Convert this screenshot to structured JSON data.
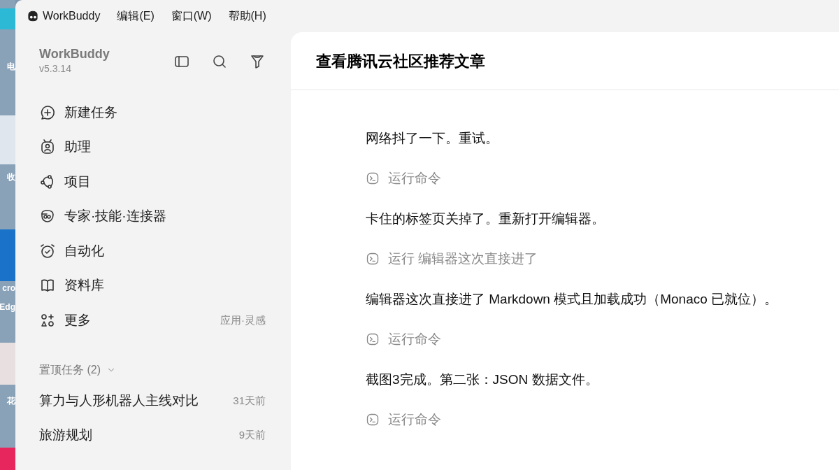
{
  "desktop_icons": [
    {
      "label": "电"
    },
    {
      "label": "收"
    },
    {
      "label": "cro"
    },
    {
      "label": "Edg"
    },
    {
      "label": "花"
    }
  ],
  "menu_bar": {
    "app_name": "WorkBuddy",
    "items": [
      "编辑(E)",
      "窗口(W)",
      "帮助(H)"
    ]
  },
  "sidebar": {
    "app_name": "WorkBuddy",
    "version": "v5.3.14",
    "nav_items": [
      {
        "kind": "new-task",
        "label": "新建任务"
      },
      {
        "kind": "assistant",
        "label": "助理"
      },
      {
        "kind": "project",
        "label": "项目"
      },
      {
        "kind": "experts",
        "label": "专家·技能·连接器"
      },
      {
        "kind": "automation",
        "label": "自动化"
      },
      {
        "kind": "library",
        "label": "资料库"
      },
      {
        "kind": "more",
        "label": "更多",
        "hint": "应用·灵感"
      }
    ],
    "pinned": {
      "title": "置顶任务 (2)",
      "expanded": true,
      "tasks": [
        {
          "title": "算力与人形机器人主线对比",
          "time": "31天前"
        },
        {
          "title": "旅游规划",
          "time": "9天前"
        }
      ]
    }
  },
  "conversation": {
    "title": "查看腾讯云社区推荐文章",
    "messages": [
      {
        "kind": "text",
        "text": "网络抖了一下。重试。"
      },
      {
        "kind": "command",
        "text": "运行命令"
      },
      {
        "kind": "text",
        "text": "卡住的标签页关掉了。重新打开编辑器。"
      },
      {
        "kind": "command",
        "text": "运行 编辑器这次直接进了"
      },
      {
        "kind": "text",
        "text": "编辑器这次直接进了 Markdown 模式且加载成功（Monaco 已就位）。"
      },
      {
        "kind": "command",
        "text": "运行命令"
      },
      {
        "kind": "text",
        "text": "截图3完成。第二张：JSON 数据文件。"
      },
      {
        "kind": "command",
        "text": "运行命令"
      }
    ]
  }
}
